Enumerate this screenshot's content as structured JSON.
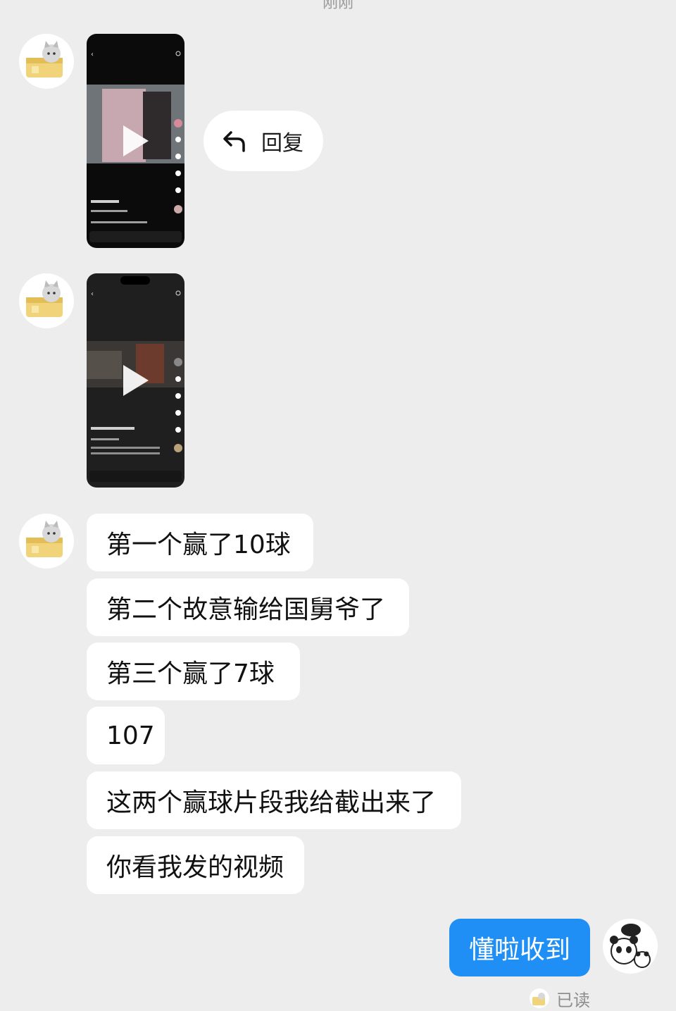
{
  "header": {
    "top_label": "刚刚"
  },
  "messages": {
    "reply_label": "回复",
    "texts": [
      "第一个赢了10球",
      "第二个故意输给国舅爷了",
      "第三个赢了7球",
      "107",
      "这两个赢球片段我给截出来了",
      "你看我发的视频"
    ],
    "my_reply": "懂啦收到",
    "read_status": "已读"
  },
  "icons": {
    "reply": "reply-arrow-icon",
    "play": "play-icon",
    "contact_avatar": "cat-in-box-avatar",
    "my_avatar": "panda-avatar"
  },
  "colors": {
    "background": "#ededed",
    "bubble_incoming": "#ffffff",
    "bubble_outgoing": "#1f8ff5",
    "read_text": "#8e8e8e"
  }
}
